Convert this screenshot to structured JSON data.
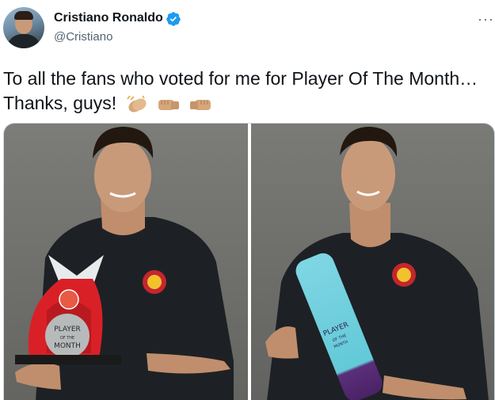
{
  "tweet": {
    "author_name": "Cristiano Ronaldo",
    "author_handle": "@Cristiano",
    "text": "To all the fans who voted for me for Player Of The Month… Thanks, guys!",
    "emojis": [
      "clapping-hands",
      "left-facing-fist",
      "right-facing-fist"
    ],
    "more_label": "···"
  },
  "media": {
    "photo_left": {
      "trophy_text": [
        "PLAYER",
        "OF THE",
        "MONTH"
      ]
    },
    "photo_right": {
      "trophy_text": [
        "PLAYER",
        "OF THE",
        "MONTH"
      ]
    }
  },
  "colors": {
    "verified": "#1d9bf0",
    "text": "#0f1419",
    "secondary": "#536471"
  }
}
